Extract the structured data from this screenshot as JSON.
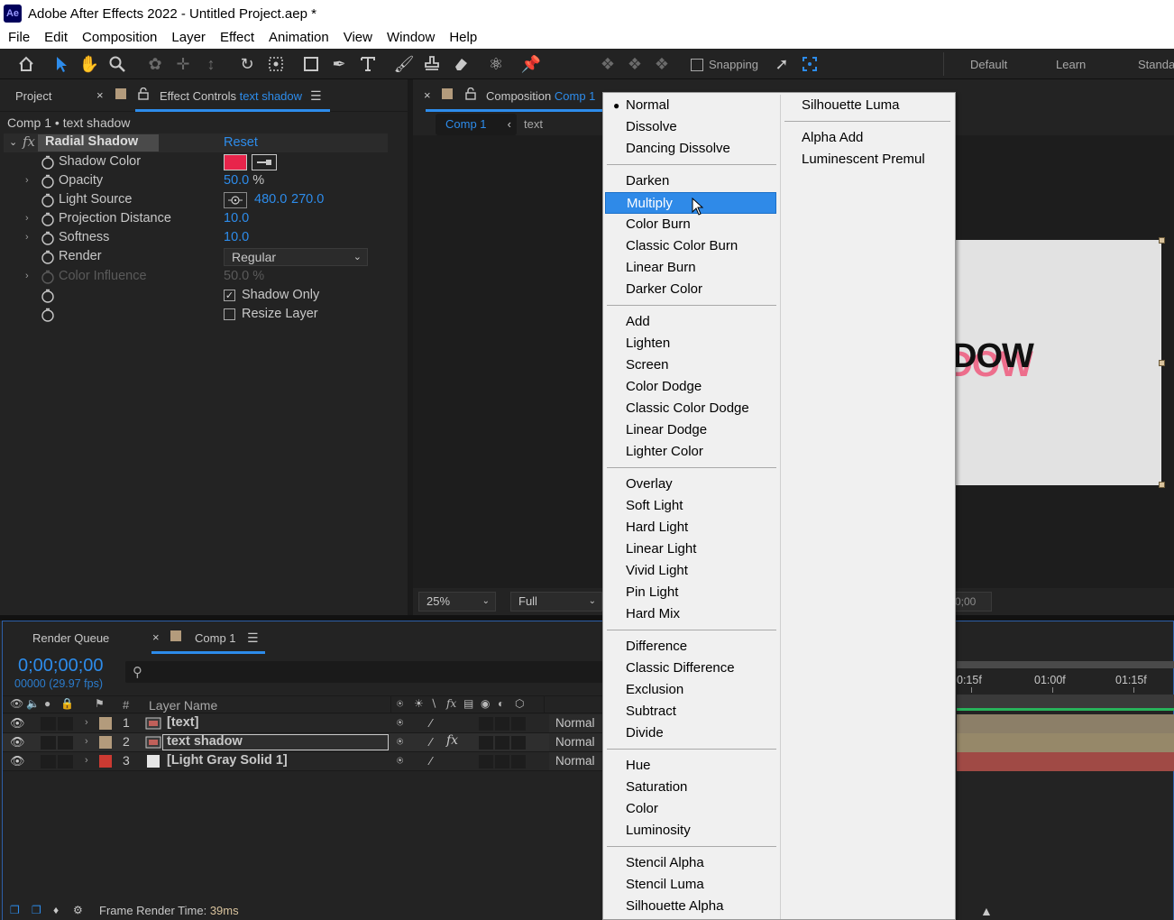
{
  "window": {
    "app_icon": "Ae",
    "title": "Adobe After Effects 2022 - Untitled Project.aep *"
  },
  "menubar": [
    "File",
    "Edit",
    "Composition",
    "Layer",
    "Effect",
    "Animation",
    "View",
    "Window",
    "Help"
  ],
  "toolbar": {
    "snapping_label": "Snapping",
    "workspaces": [
      "Default",
      "Learn",
      "Standa"
    ]
  },
  "effect_controls": {
    "tab_project": "Project",
    "tab_effect_controls_prefix": "Effect Controls",
    "tab_effect_controls_layer": "text shadow",
    "header": "Comp 1 • text shadow",
    "fx_label": "fx",
    "effect_name": "Radial Shadow",
    "reset_label": "Reset",
    "properties": {
      "shadow_color": {
        "label": "Shadow Color",
        "color": "#e8244b"
      },
      "opacity": {
        "label": "Opacity",
        "value": "50.0",
        "unit": "%"
      },
      "light_source": {
        "label": "Light Source",
        "x": "480.0",
        "y": "270.0"
      },
      "projection_distance": {
        "label": "Projection Distance",
        "value": "10.0"
      },
      "softness": {
        "label": "Softness",
        "value": "10.0"
      },
      "render": {
        "label": "Render",
        "value": "Regular"
      },
      "color_influence": {
        "label": "Color Influence",
        "value": "50.0",
        "unit": "%"
      },
      "shadow_only": {
        "label": "Shadow Only",
        "checked": true
      },
      "resize_layer": {
        "label": "Resize Layer",
        "checked": false
      }
    }
  },
  "composition": {
    "tab_prefix": "Composition",
    "tab_name": "Comp 1",
    "breadcrumb_comp": "Comp 1",
    "breadcrumb_layer": "text",
    "preview_text_main": "DOW",
    "preview_text_shadow": "DOW",
    "zoom": "25%",
    "resolution": "Full",
    "timecode_partial": "0;00"
  },
  "timeline": {
    "tab_render_queue": "Render Queue",
    "tab_comp": "Comp 1",
    "timecode": "0;00;00;00",
    "fps": "00000 (29.97 fps)",
    "col_num": "#",
    "col_layer_name": "Layer Name",
    "ruler_labels": [
      "0:15f",
      "01:00f",
      "01:15f"
    ],
    "layers": [
      {
        "num": "1",
        "name": "[text]",
        "mode": "Normal",
        "label_color": "#b39b7c",
        "track_color": "#8c7f68"
      },
      {
        "num": "2",
        "name": "text shadow",
        "mode": "Normal",
        "label_color": "#b39b7c",
        "track_color": "#8c7f68"
      },
      {
        "num": "3",
        "name": "[Light Gray Solid 1]",
        "mode": "Normal",
        "label_color": "#cc3a32",
        "track_color": "#a04a45"
      }
    ],
    "frame_render_label": "Frame Render Time:",
    "frame_render_value": "39ms"
  },
  "blend_menu": {
    "selected": "Normal",
    "highlighted": "Multiply",
    "col1_groups": [
      [
        "Normal",
        "Dissolve",
        "Dancing Dissolve"
      ],
      [
        "Darken",
        "Multiply",
        "Color Burn",
        "Classic Color Burn",
        "Linear Burn",
        "Darker Color"
      ],
      [
        "Add",
        "Lighten",
        "Screen",
        "Color Dodge",
        "Classic Color Dodge",
        "Linear Dodge",
        "Lighter Color"
      ],
      [
        "Overlay",
        "Soft Light",
        "Hard Light",
        "Linear Light",
        "Vivid Light",
        "Pin Light",
        "Hard Mix"
      ],
      [
        "Difference",
        "Classic Difference",
        "Exclusion",
        "Subtract",
        "Divide"
      ],
      [
        "Hue",
        "Saturation",
        "Color",
        "Luminosity"
      ],
      [
        "Stencil Alpha",
        "Stencil Luma",
        "Silhouette Alpha"
      ]
    ],
    "col2_groups": [
      [
        "Silhouette Luma"
      ],
      [
        "Alpha Add",
        "Luminescent Premul"
      ]
    ]
  }
}
